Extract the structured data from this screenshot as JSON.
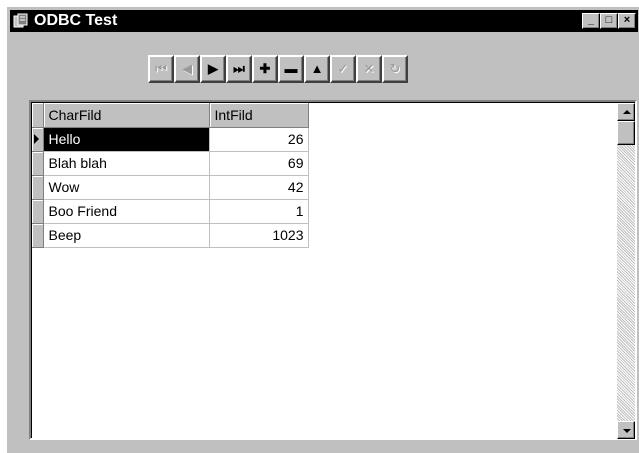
{
  "window": {
    "title": "ODBC Test",
    "controls": {
      "minimize": "_",
      "maximize": "□",
      "close": "×"
    }
  },
  "navigator": {
    "buttons": [
      {
        "name": "first-record",
        "glyph": "⏮",
        "enabled": false
      },
      {
        "name": "prior-record",
        "glyph": "◀",
        "enabled": false
      },
      {
        "name": "next-record",
        "glyph": "▶",
        "enabled": true
      },
      {
        "name": "last-record",
        "glyph": "⏭",
        "enabled": true
      },
      {
        "name": "insert-record",
        "glyph": "✚",
        "enabled": true
      },
      {
        "name": "delete-record",
        "glyph": "▬",
        "enabled": true
      },
      {
        "name": "edit-record",
        "glyph": "▲",
        "enabled": true
      },
      {
        "name": "post-edit",
        "glyph": "✓",
        "enabled": false
      },
      {
        "name": "cancel-edit",
        "glyph": "✕",
        "enabled": false
      },
      {
        "name": "refresh-data",
        "glyph": "↻",
        "enabled": false
      }
    ]
  },
  "grid": {
    "columns": [
      "CharFild",
      "IntFild"
    ],
    "rows": [
      {
        "char": "Hello",
        "int": "26"
      },
      {
        "char": "Blah blah",
        "int": "69"
      },
      {
        "char": "Wow",
        "int": "42"
      },
      {
        "char": "Boo Friend",
        "int": "1"
      },
      {
        "char": "Beep",
        "int": "1023"
      }
    ],
    "current_row": 0
  },
  "colors": {
    "titlebar": "#000000",
    "face": "#c0c0c0",
    "selection": "#000000"
  }
}
